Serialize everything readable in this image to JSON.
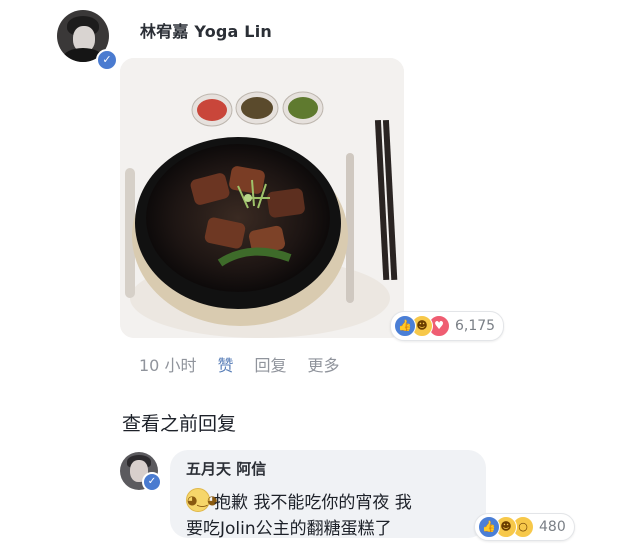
{
  "post": {
    "author": "林宥嘉 Yoga Lin",
    "reactions_count": "6,175",
    "reaction_icons": [
      "like-icon",
      "haha-icon",
      "love-icon"
    ],
    "timestamp": "10 小时",
    "actions": {
      "like": "赞",
      "reply": "回复",
      "more": "更多"
    }
  },
  "view_previous": "查看之前回复",
  "comment": {
    "author": "五月天 阿信",
    "line1": "抱歉 我不能吃你的宵夜 我",
    "line2": "要吃Jolin公主的翻糖蛋糕了",
    "reactions_count": "480",
    "reaction_icons": [
      "like-icon",
      "haha-icon",
      "wow-icon"
    ]
  },
  "colors": {
    "accent": "#4b7fd6",
    "bubble": "#f0f2f5",
    "muted_text": "#90949c"
  }
}
